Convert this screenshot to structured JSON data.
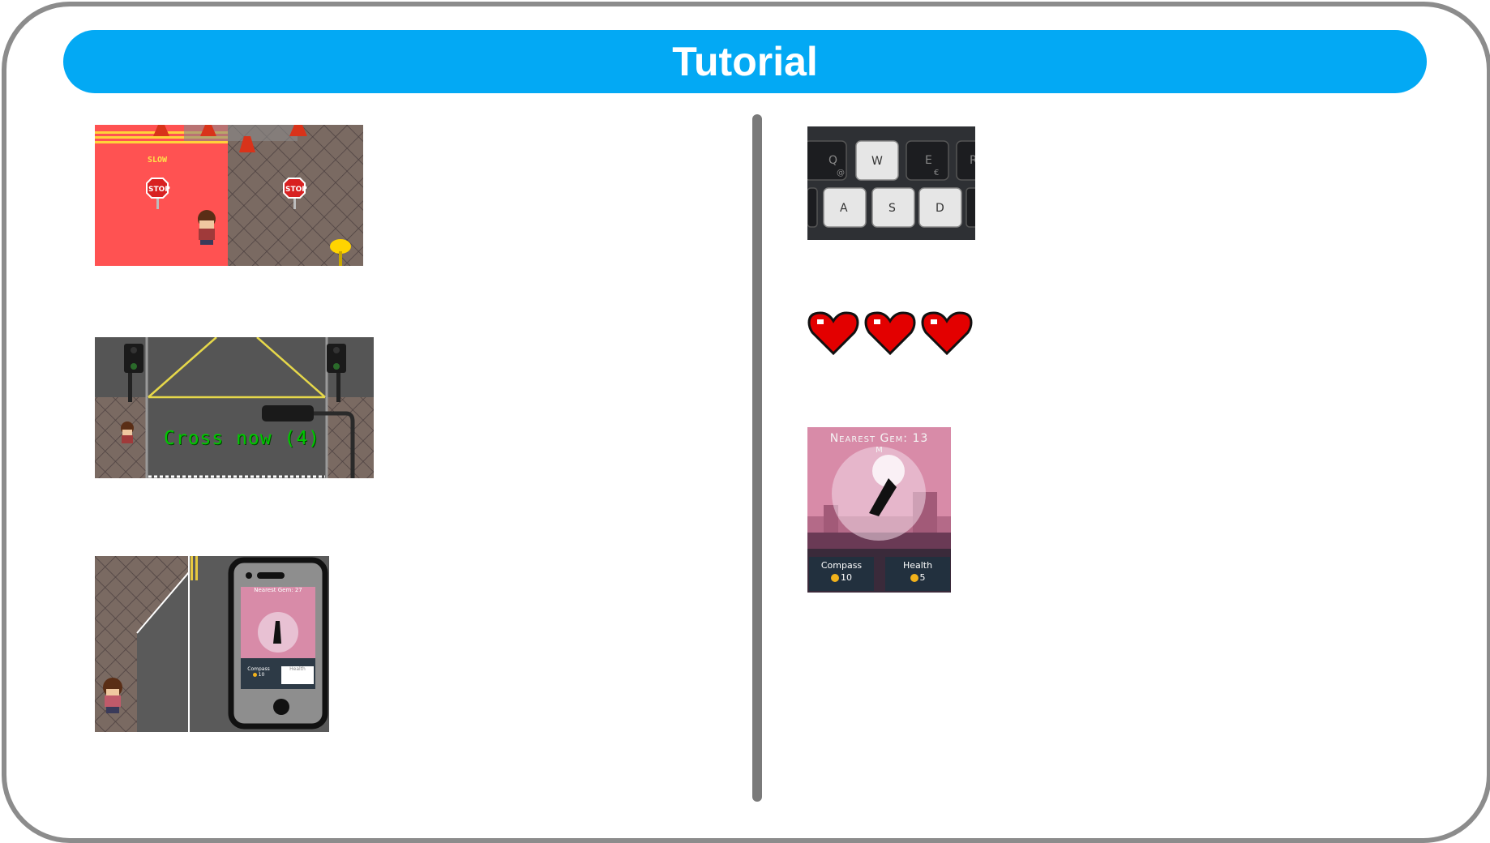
{
  "header": {
    "title": "Tutorial"
  },
  "left": {
    "zone_tile": {
      "slow_label": "SLOW",
      "stop_label": "STOP"
    },
    "crossing_tile": {
      "message": "Cross now (4)"
    },
    "phone_tile": {
      "phone_title": "Nearest Gem: 27",
      "compass_label": "Compass",
      "compass_price": "10",
      "health_label": "Health"
    }
  },
  "right": {
    "keys_tile": {
      "keys_top": [
        "Q",
        "W",
        "E",
        "R"
      ],
      "keys_bottom": [
        "A",
        "S",
        "D"
      ],
      "q_sub": "@",
      "e_sub": "€"
    },
    "hearts_tile": {
      "count": 3
    },
    "gem_tile": {
      "title": "Nearest Gem: 13",
      "unit": "M",
      "compass_label": "Compass",
      "compass_price": "10",
      "health_label": "Health",
      "health_price": "5"
    }
  },
  "colors": {
    "banner": "#03a9f4",
    "frame": "#8c8c8c",
    "divider": "#7a7a7a",
    "cross_text": "#00c800"
  }
}
